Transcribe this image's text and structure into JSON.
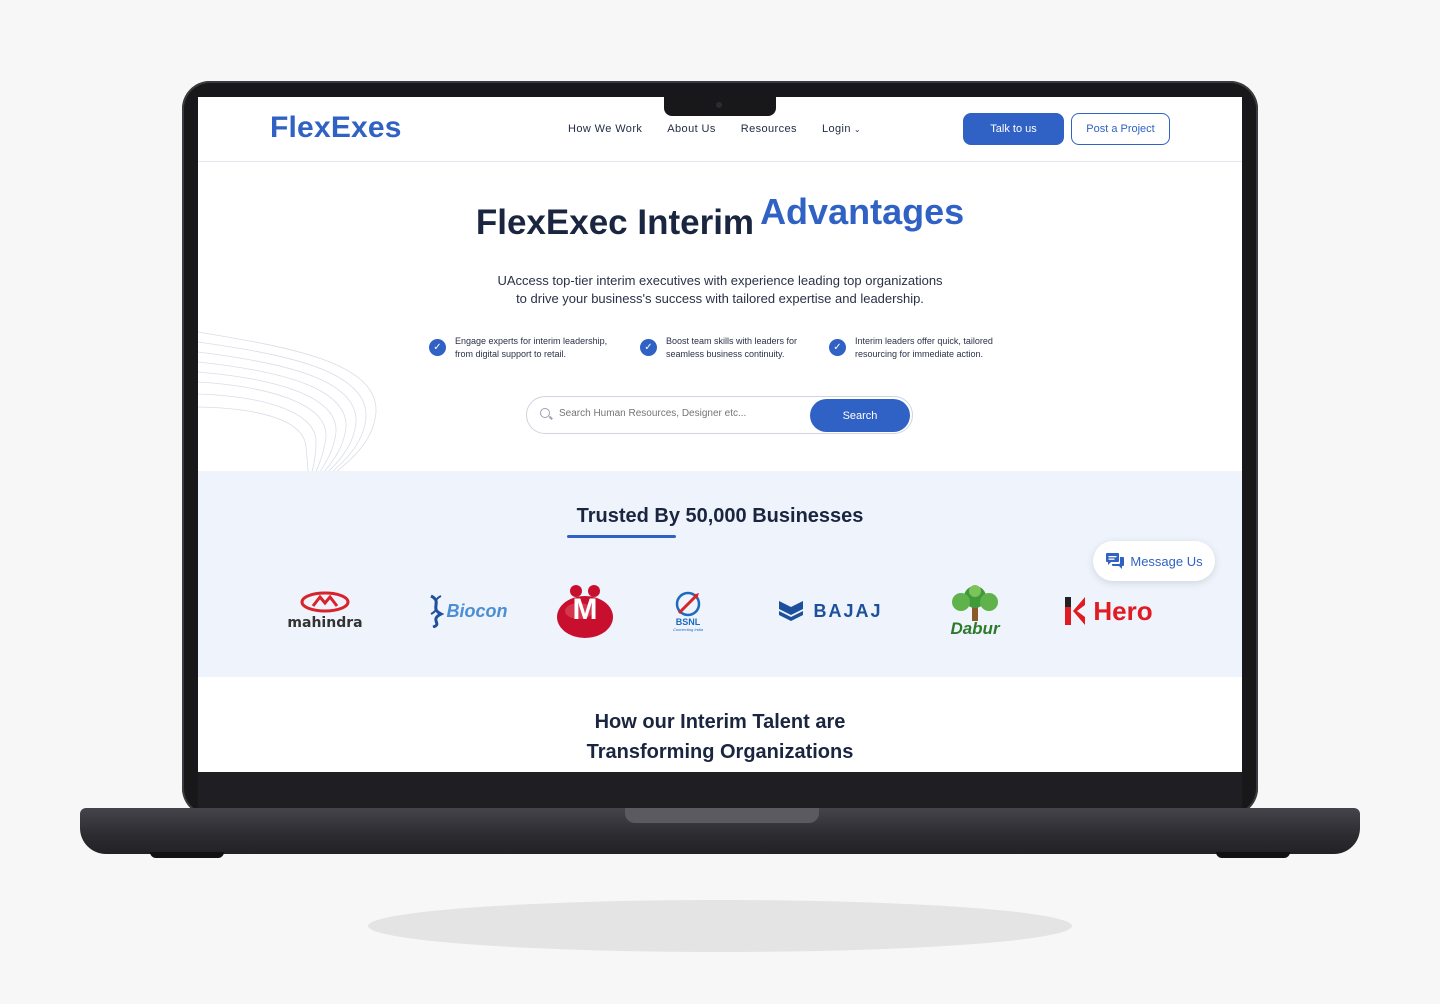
{
  "nav": {
    "logo": "FlexExes",
    "links": [
      "How We Work",
      "About Us",
      "Resources",
      "Login"
    ],
    "talk_button": "Talk to us",
    "post_button": "Post a Project"
  },
  "hero": {
    "title_main": "FlexExec Interim",
    "title_accent": "Advantages",
    "subtitle_line1": "UAccess top-tier interim executives with experience leading top organizations",
    "subtitle_line2": "to drive your business's success with tailored expertise and leadership.",
    "features": [
      {
        "line1": "Engage experts for interim leadership,",
        "line2": "from digital support to retail."
      },
      {
        "line1": "Boost team skills with leaders for",
        "line2": "seamless business continuity."
      },
      {
        "line1": "Interim leaders offer quick, tailored",
        "line2": "resourcing for immediate action."
      }
    ],
    "search_placeholder": "Search Human Resources, Designer etc...",
    "search_button": "Search"
  },
  "trusted": {
    "title": "Trusted By 50,000 Businesses",
    "logos": [
      "mahindra",
      "Biocon",
      "M",
      "BSNL",
      "BAJAJ",
      "Dabur",
      "Hero"
    ],
    "bsnl_tagline": "Connecting India"
  },
  "message_button": "Message Us",
  "section": {
    "title_line1": "How our Interim Talent are",
    "title_line2": "Transforming Organizations"
  },
  "colors": {
    "brand": "#2f62c4",
    "heading": "#1a2540",
    "band": "#eef3fc"
  }
}
